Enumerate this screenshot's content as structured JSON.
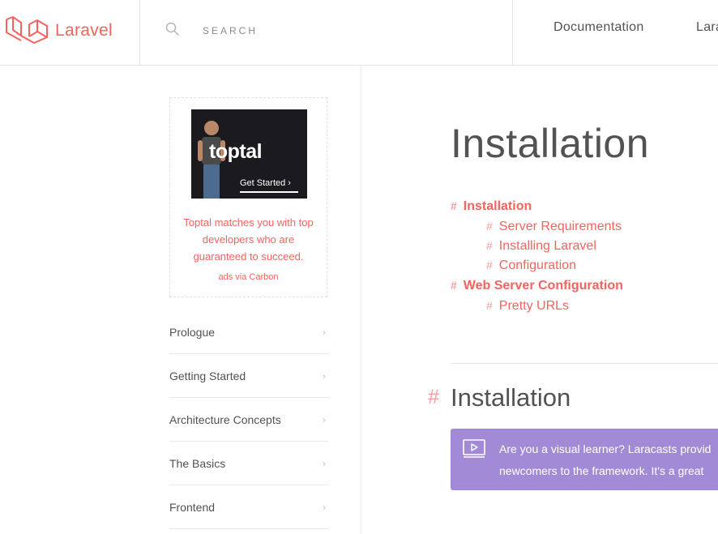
{
  "header": {
    "logo_text": "Laravel",
    "search_placeholder": "SEARCH",
    "nav": [
      "Documentation",
      "Lara"
    ]
  },
  "ad": {
    "brand": "toptal",
    "cta": "Get Started  ›",
    "text": "Toptal matches you with top developers who are guaranteed to succeed.",
    "via": "ads via Carbon"
  },
  "sidebar": {
    "items": [
      {
        "label": "Prologue"
      },
      {
        "label": "Getting Started"
      },
      {
        "label": "Architecture Concepts"
      },
      {
        "label": "The Basics"
      },
      {
        "label": "Frontend"
      }
    ],
    "chevron": "›"
  },
  "main": {
    "title": "Installation",
    "toc": [
      {
        "hash": "#",
        "label": "Installation",
        "level": 1
      },
      {
        "hash": "#",
        "label": "Server Requirements",
        "level": 2
      },
      {
        "hash": "#",
        "label": "Installing Laravel",
        "level": 2
      },
      {
        "hash": "#",
        "label": "Configuration",
        "level": 2
      },
      {
        "hash": "#",
        "label": "Web Server Configuration",
        "level": 1
      },
      {
        "hash": "#",
        "label": "Pretty URLs",
        "level": 2
      }
    ],
    "section_hash": "#",
    "section_title": "Installation",
    "callout_line1": "Are you a visual learner? Laracasts provid",
    "callout_line2": "newcomers to the framework. It's a great"
  },
  "colors": {
    "accent": "#f4645f",
    "callout": "#a28ad6",
    "text": "#525252"
  }
}
